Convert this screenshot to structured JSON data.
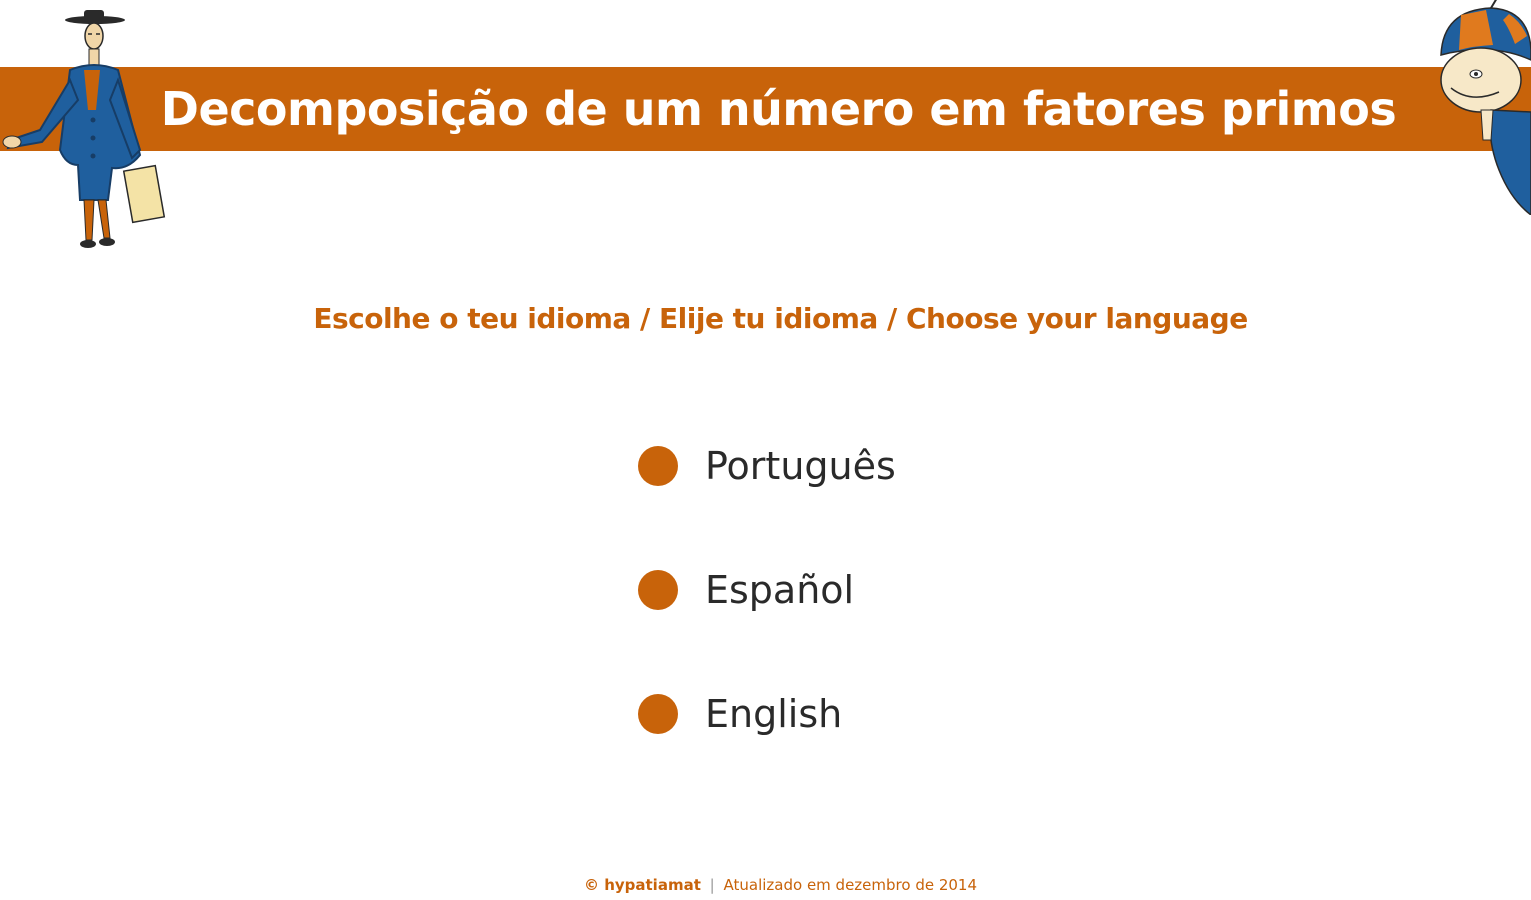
{
  "header": {
    "title": "Decomposição de um número em fatores primos"
  },
  "prompt": "Escolhe o teu idioma / Elije tu idioma / Choose your language",
  "languages": [
    {
      "label": "Português"
    },
    {
      "label": "Español"
    },
    {
      "label": "English"
    }
  ],
  "footer": {
    "copyright": "© hypatiamat",
    "separator": "|",
    "updated": "Atualizado em dezembro de 2014"
  },
  "colors": {
    "accent": "#c8630a",
    "banner_text": "#ffffff",
    "option_text": "#2a2a2a",
    "coat_blue": "#1f5f9e"
  },
  "icons": {
    "left": "cartoon-man-illustration",
    "right": "cartoon-boy-cap-illustration",
    "option_bullet": "orange-circle-bullet"
  }
}
